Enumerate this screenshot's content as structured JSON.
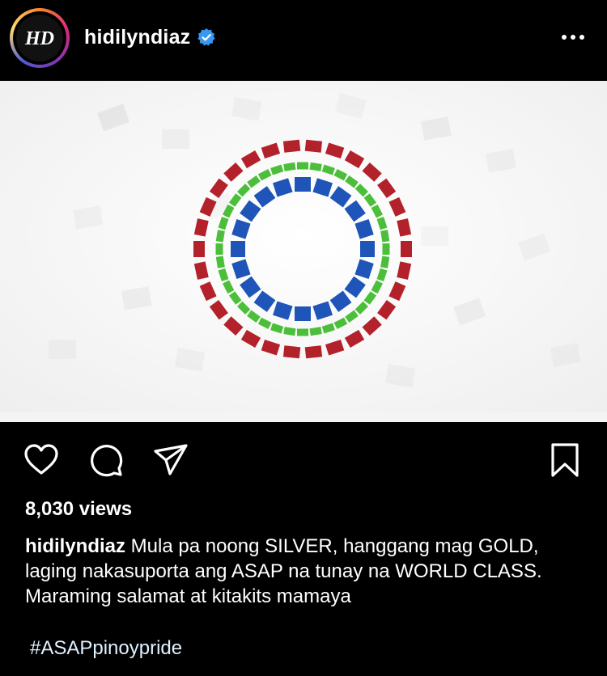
{
  "post": {
    "username": "hidilyndiaz",
    "verified": true,
    "avatar_monogram": "HD",
    "views": "8,030 views",
    "caption_user": "hidilyndiaz",
    "caption_text": " Mula pa noong SILVER, hanggang mag GOLD, laging nakasuporta ang ASAP na tunay na WORLD CLASS. Maraming salamat at kitakits mamaya",
    "hashtag": "#ASAPpinoypride"
  },
  "media": {
    "description_icon": "abs-cbn-rings-logo",
    "ring_colors": {
      "outer": "#b3222b",
      "middle": "#4cbf3a",
      "inner": "#1f55b8"
    }
  },
  "icons": {
    "like": "heart-icon",
    "comment": "comment-icon",
    "share": "share-icon",
    "save": "bookmark-icon",
    "more": "more-options-icon",
    "verified": "verified-badge-icon"
  },
  "colors": {
    "background": "#000000",
    "text": "#ffffff",
    "hashtag": "#e0f1ff",
    "verified": "#3897f0"
  }
}
